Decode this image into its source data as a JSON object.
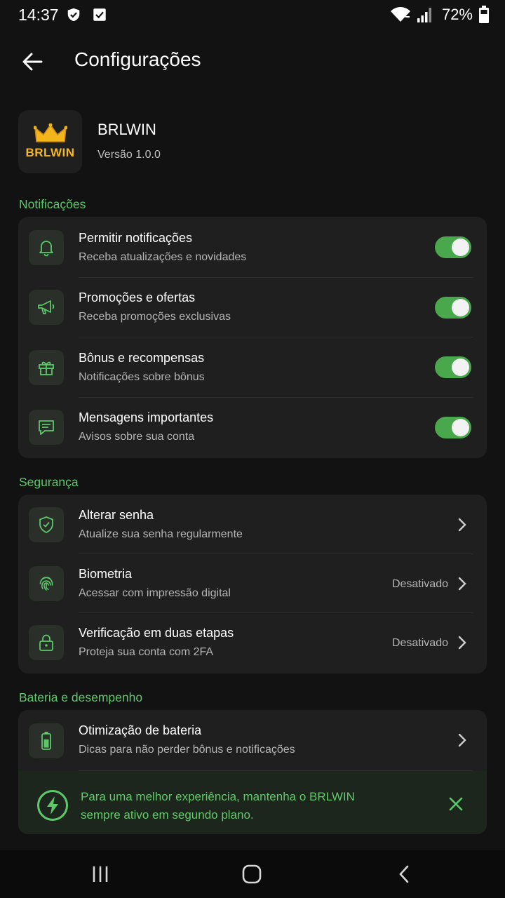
{
  "status_bar": {
    "time": "14:37",
    "battery_percent": "72%",
    "icons": [
      "shield-check-icon",
      "checkbox-icon",
      "wifi-icon",
      "signal-icon",
      "battery-icon"
    ]
  },
  "header": {
    "title": "Configurações",
    "back_icon": "arrow-left-icon"
  },
  "app": {
    "logo_text": "BRLWIN",
    "name": "BRLWIN",
    "version": "Versão 1.0.0"
  },
  "colors": {
    "accent": "#5cc86a",
    "toggle_on": "#49a84b",
    "card": "#1f1f1f",
    "background": "#121212"
  },
  "sections": {
    "notifications": {
      "label": "Notificações",
      "items": [
        {
          "title": "Permitir notificações",
          "subtitle": "Receba atualizações e novidades",
          "icon": "bell-icon",
          "enabled": true
        },
        {
          "title": "Promoções e ofertas",
          "subtitle": "Receba promoções exclusivas",
          "icon": "megaphone-icon",
          "enabled": true
        },
        {
          "title": "Bônus e recompensas",
          "subtitle": "Notificações sobre bônus",
          "icon": "gift-icon",
          "enabled": true
        },
        {
          "title": "Mensagens importantes",
          "subtitle": "Avisos sobre sua conta",
          "icon": "message-icon",
          "enabled": true
        }
      ]
    },
    "security": {
      "label": "Segurança",
      "items": [
        {
          "title": "Alterar senha",
          "subtitle": "Atualize sua senha regularmente",
          "icon": "shield-icon",
          "value": ""
        },
        {
          "title": "Biometria",
          "subtitle": "Acessar com impressão digital",
          "icon": "fingerprint-icon",
          "value": "Desativado"
        },
        {
          "title": "Verificação em duas etapas",
          "subtitle": "Proteja sua conta com 2FA",
          "icon": "lock-icon",
          "value": "Desativado"
        }
      ]
    },
    "battery": {
      "label": "Bateria e desempenho",
      "items": [
        {
          "title": "Otimização de bateria",
          "subtitle": "Dicas para não perder bônus e notificações",
          "icon": "battery-icon"
        }
      ],
      "tip": "Para uma melhor experiência, mantenha o BRLWIN sempre ativo em segundo plano."
    }
  },
  "nav_bar": {
    "buttons": [
      "recents-icon",
      "home-icon",
      "back-icon"
    ]
  }
}
